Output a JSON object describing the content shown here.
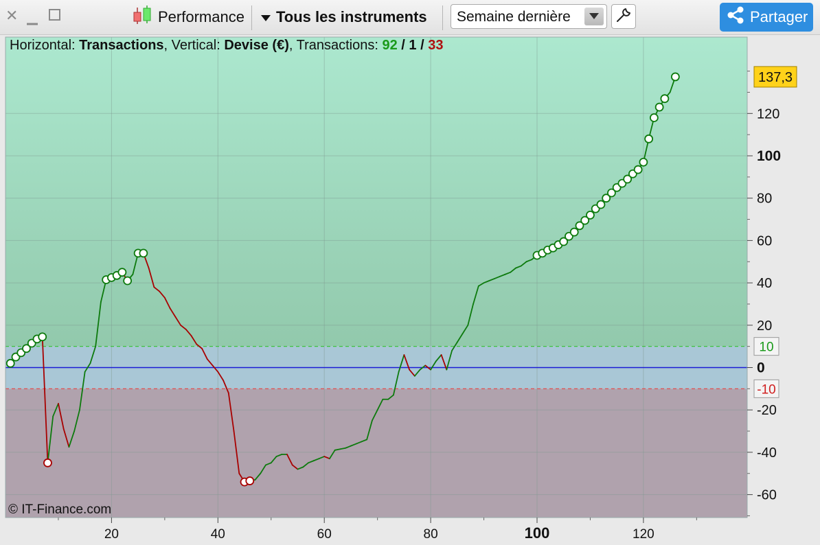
{
  "toolbar": {
    "performance_label": "Performance",
    "instruments_label": "Tous les instruments",
    "period_value": "Semaine dernière",
    "share_label": "Partager"
  },
  "info": {
    "h_label": "Horizontal: ",
    "h_value": "Transactions",
    "v_label": ", Vertical: ",
    "v_value": "Devise (€)",
    "t_label": ", Transactions: ",
    "wins": "92",
    "slash1": " / ",
    "neutral": "1",
    "slash2": " / ",
    "losses": "33"
  },
  "copyright": "© IT-Finance.com",
  "colors": {
    "profit_zone": "#a8e3c8",
    "neutral_zone": "#a9c7d6",
    "loss_zone": "#b0a2ad",
    "up_line": "#0d7a0d",
    "down_line": "#a80000",
    "zero_line": "#1a1ad6",
    "last_value_bg": "#ffd21a"
  },
  "chart_data": {
    "type": "line",
    "xlim": [
      0,
      140
    ],
    "ylim": [
      -70,
      150
    ],
    "x_ticks": [
      "20",
      "40",
      "60",
      "80",
      "100",
      "120"
    ],
    "y_ticks": [
      "120",
      "100",
      "80",
      "60",
      "40",
      "20",
      "0",
      "-20",
      "-40",
      "-60"
    ],
    "y_ticks_bold": [
      "100",
      "0"
    ],
    "x_ticks_bold": [
      "100"
    ],
    "upper_threshold": {
      "value": 10,
      "label": "10"
    },
    "lower_threshold": {
      "value": -10,
      "label": "-10"
    },
    "last_value_label": "137,3",
    "x": [
      1,
      2,
      3,
      4,
      5,
      6,
      7,
      8,
      9,
      10,
      11,
      12,
      13,
      14,
      15,
      16,
      17,
      18,
      19,
      20,
      21,
      22,
      23,
      24,
      25,
      26,
      27,
      28,
      29,
      30,
      31,
      32,
      33,
      34,
      35,
      36,
      37,
      38,
      39,
      40,
      41,
      42,
      43,
      44,
      45,
      46,
      47,
      48,
      49,
      50,
      51,
      52,
      53,
      54,
      55,
      56,
      57,
      58,
      59,
      60,
      61,
      62,
      63,
      64,
      65,
      66,
      67,
      68,
      69,
      70,
      71,
      72,
      73,
      74,
      75,
      76,
      77,
      78,
      79,
      80,
      81,
      82,
      83,
      84,
      85,
      86,
      87,
      88,
      89,
      90,
      91,
      92,
      93,
      94,
      95,
      96,
      97,
      98,
      99,
      100,
      101,
      102,
      103,
      104,
      105,
      106,
      107,
      108,
      109,
      110,
      111,
      112,
      113,
      114,
      115,
      116,
      117,
      118,
      119,
      120,
      121,
      122,
      123,
      124,
      125,
      126
    ],
    "y": [
      2,
      5,
      7,
      9,
      11.5,
      13.5,
      14.5,
      -45,
      -23,
      -17,
      -29,
      -37.5,
      -30,
      -20,
      -2,
      2,
      10,
      31,
      41.5,
      42.5,
      43.5,
      45,
      41,
      44,
      54,
      54,
      47,
      38,
      36,
      33,
      28,
      24,
      20,
      18,
      15,
      11,
      9,
      4,
      1,
      -2,
      -6,
      -12,
      -30,
      -50,
      -54,
      -53.5,
      -53,
      -50,
      -46,
      -45,
      -42,
      -41,
      -41,
      -46,
      -48,
      -47,
      -45,
      -44,
      -43,
      -42,
      -43,
      -39,
      -38.5,
      -38,
      -37,
      -36,
      -35,
      -34,
      -25,
      -20,
      -15,
      -15,
      -13,
      -2,
      6,
      -1,
      -4,
      -1,
      1,
      -1,
      3,
      6,
      -1,
      8,
      12,
      16,
      20,
      30,
      38.5,
      40,
      41,
      42,
      43,
      44,
      45,
      47,
      48,
      50,
      51,
      53,
      54,
      55.5,
      56.5,
      58,
      59.5,
      62,
      64,
      67,
      69.5,
      72,
      75,
      77,
      80,
      82.5,
      85,
      87,
      89,
      91.5,
      93.5,
      97,
      108,
      118,
      123,
      127,
      130,
      137.3
    ],
    "markers": [
      1,
      2,
      3,
      4,
      5,
      6,
      7,
      8,
      19,
      20,
      21,
      22,
      23,
      25,
      26,
      45,
      46,
      100,
      101,
      102,
      103,
      104,
      105,
      106,
      107,
      108,
      109,
      110,
      111,
      112,
      113,
      114,
      115,
      116,
      117,
      118,
      119,
      120,
      121,
      122,
      123,
      124,
      126
    ]
  }
}
